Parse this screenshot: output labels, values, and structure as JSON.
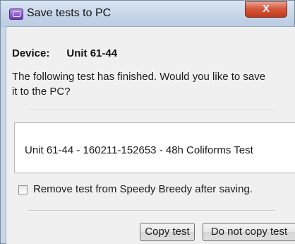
{
  "window": {
    "title": "Save tests to PC",
    "close_label": "X"
  },
  "device": {
    "label": "Device:",
    "value": "Unit 61-44"
  },
  "message": {
    "line1": "The following test has finished. Would you like to save",
    "line2": "it to the PC?"
  },
  "test": {
    "name": "Unit 61-44 - 160211-152653 - 48h Coliforms Test"
  },
  "options": {
    "remove_label": "Remove test from Speedy Breedy after saving.",
    "remove_checked": false
  },
  "buttons": {
    "copy": "Copy test",
    "no_copy": "Do not copy test"
  },
  "colors": {
    "title_bar": "#c6d5e8",
    "close_button": "#d5573c",
    "dialog_background": "#f0f0f0"
  }
}
